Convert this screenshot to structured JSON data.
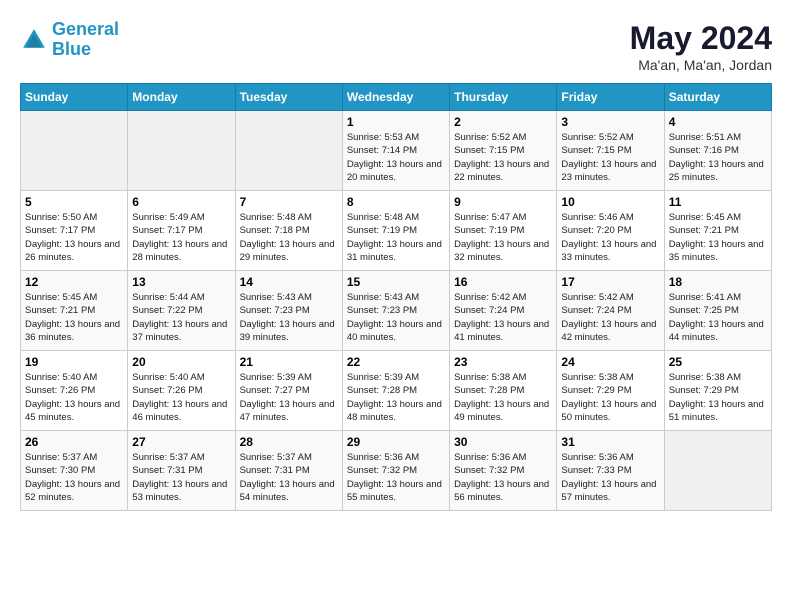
{
  "logo": {
    "line1": "General",
    "line2": "Blue"
  },
  "title": "May 2024",
  "location": "Ma'an, Ma'an, Jordan",
  "weekdays": [
    "Sunday",
    "Monday",
    "Tuesday",
    "Wednesday",
    "Thursday",
    "Friday",
    "Saturday"
  ],
  "weeks": [
    [
      {
        "day": "",
        "sunrise": "",
        "sunset": "",
        "daylight": ""
      },
      {
        "day": "",
        "sunrise": "",
        "sunset": "",
        "daylight": ""
      },
      {
        "day": "",
        "sunrise": "",
        "sunset": "",
        "daylight": ""
      },
      {
        "day": "1",
        "sunrise": "Sunrise: 5:53 AM",
        "sunset": "Sunset: 7:14 PM",
        "daylight": "Daylight: 13 hours and 20 minutes."
      },
      {
        "day": "2",
        "sunrise": "Sunrise: 5:52 AM",
        "sunset": "Sunset: 7:15 PM",
        "daylight": "Daylight: 13 hours and 22 minutes."
      },
      {
        "day": "3",
        "sunrise": "Sunrise: 5:52 AM",
        "sunset": "Sunset: 7:15 PM",
        "daylight": "Daylight: 13 hours and 23 minutes."
      },
      {
        "day": "4",
        "sunrise": "Sunrise: 5:51 AM",
        "sunset": "Sunset: 7:16 PM",
        "daylight": "Daylight: 13 hours and 25 minutes."
      }
    ],
    [
      {
        "day": "5",
        "sunrise": "Sunrise: 5:50 AM",
        "sunset": "Sunset: 7:17 PM",
        "daylight": "Daylight: 13 hours and 26 minutes."
      },
      {
        "day": "6",
        "sunrise": "Sunrise: 5:49 AM",
        "sunset": "Sunset: 7:17 PM",
        "daylight": "Daylight: 13 hours and 28 minutes."
      },
      {
        "day": "7",
        "sunrise": "Sunrise: 5:48 AM",
        "sunset": "Sunset: 7:18 PM",
        "daylight": "Daylight: 13 hours and 29 minutes."
      },
      {
        "day": "8",
        "sunrise": "Sunrise: 5:48 AM",
        "sunset": "Sunset: 7:19 PM",
        "daylight": "Daylight: 13 hours and 31 minutes."
      },
      {
        "day": "9",
        "sunrise": "Sunrise: 5:47 AM",
        "sunset": "Sunset: 7:19 PM",
        "daylight": "Daylight: 13 hours and 32 minutes."
      },
      {
        "day": "10",
        "sunrise": "Sunrise: 5:46 AM",
        "sunset": "Sunset: 7:20 PM",
        "daylight": "Daylight: 13 hours and 33 minutes."
      },
      {
        "day": "11",
        "sunrise": "Sunrise: 5:45 AM",
        "sunset": "Sunset: 7:21 PM",
        "daylight": "Daylight: 13 hours and 35 minutes."
      }
    ],
    [
      {
        "day": "12",
        "sunrise": "Sunrise: 5:45 AM",
        "sunset": "Sunset: 7:21 PM",
        "daylight": "Daylight: 13 hours and 36 minutes."
      },
      {
        "day": "13",
        "sunrise": "Sunrise: 5:44 AM",
        "sunset": "Sunset: 7:22 PM",
        "daylight": "Daylight: 13 hours and 37 minutes."
      },
      {
        "day": "14",
        "sunrise": "Sunrise: 5:43 AM",
        "sunset": "Sunset: 7:23 PM",
        "daylight": "Daylight: 13 hours and 39 minutes."
      },
      {
        "day": "15",
        "sunrise": "Sunrise: 5:43 AM",
        "sunset": "Sunset: 7:23 PM",
        "daylight": "Daylight: 13 hours and 40 minutes."
      },
      {
        "day": "16",
        "sunrise": "Sunrise: 5:42 AM",
        "sunset": "Sunset: 7:24 PM",
        "daylight": "Daylight: 13 hours and 41 minutes."
      },
      {
        "day": "17",
        "sunrise": "Sunrise: 5:42 AM",
        "sunset": "Sunset: 7:24 PM",
        "daylight": "Daylight: 13 hours and 42 minutes."
      },
      {
        "day": "18",
        "sunrise": "Sunrise: 5:41 AM",
        "sunset": "Sunset: 7:25 PM",
        "daylight": "Daylight: 13 hours and 44 minutes."
      }
    ],
    [
      {
        "day": "19",
        "sunrise": "Sunrise: 5:40 AM",
        "sunset": "Sunset: 7:26 PM",
        "daylight": "Daylight: 13 hours and 45 minutes."
      },
      {
        "day": "20",
        "sunrise": "Sunrise: 5:40 AM",
        "sunset": "Sunset: 7:26 PM",
        "daylight": "Daylight: 13 hours and 46 minutes."
      },
      {
        "day": "21",
        "sunrise": "Sunrise: 5:39 AM",
        "sunset": "Sunset: 7:27 PM",
        "daylight": "Daylight: 13 hours and 47 minutes."
      },
      {
        "day": "22",
        "sunrise": "Sunrise: 5:39 AM",
        "sunset": "Sunset: 7:28 PM",
        "daylight": "Daylight: 13 hours and 48 minutes."
      },
      {
        "day": "23",
        "sunrise": "Sunrise: 5:38 AM",
        "sunset": "Sunset: 7:28 PM",
        "daylight": "Daylight: 13 hours and 49 minutes."
      },
      {
        "day": "24",
        "sunrise": "Sunrise: 5:38 AM",
        "sunset": "Sunset: 7:29 PM",
        "daylight": "Daylight: 13 hours and 50 minutes."
      },
      {
        "day": "25",
        "sunrise": "Sunrise: 5:38 AM",
        "sunset": "Sunset: 7:29 PM",
        "daylight": "Daylight: 13 hours and 51 minutes."
      }
    ],
    [
      {
        "day": "26",
        "sunrise": "Sunrise: 5:37 AM",
        "sunset": "Sunset: 7:30 PM",
        "daylight": "Daylight: 13 hours and 52 minutes."
      },
      {
        "day": "27",
        "sunrise": "Sunrise: 5:37 AM",
        "sunset": "Sunset: 7:31 PM",
        "daylight": "Daylight: 13 hours and 53 minutes."
      },
      {
        "day": "28",
        "sunrise": "Sunrise: 5:37 AM",
        "sunset": "Sunset: 7:31 PM",
        "daylight": "Daylight: 13 hours and 54 minutes."
      },
      {
        "day": "29",
        "sunrise": "Sunrise: 5:36 AM",
        "sunset": "Sunset: 7:32 PM",
        "daylight": "Daylight: 13 hours and 55 minutes."
      },
      {
        "day": "30",
        "sunrise": "Sunrise: 5:36 AM",
        "sunset": "Sunset: 7:32 PM",
        "daylight": "Daylight: 13 hours and 56 minutes."
      },
      {
        "day": "31",
        "sunrise": "Sunrise: 5:36 AM",
        "sunset": "Sunset: 7:33 PM",
        "daylight": "Daylight: 13 hours and 57 minutes."
      },
      {
        "day": "",
        "sunrise": "",
        "sunset": "",
        "daylight": ""
      }
    ]
  ]
}
